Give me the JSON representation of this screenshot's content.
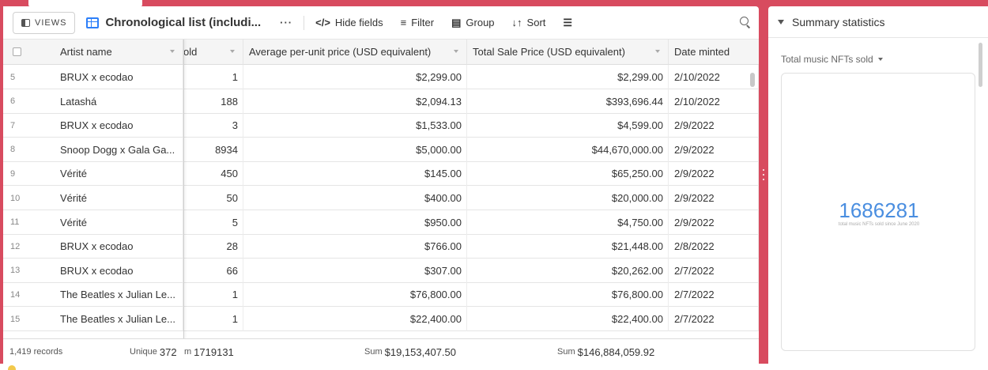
{
  "toolbar": {
    "views_label": "VIEWS",
    "view_name": "Chronological list (includi...",
    "more_label": "···",
    "hide_fields_label": "Hide fields",
    "filter_label": "Filter",
    "group_label": "Group",
    "sort_label": "Sort",
    "icons": [
      "views-icon",
      "grid-view-icon",
      "more-icon",
      "hide-fields-icon",
      "filter-icon",
      "group-icon",
      "sort-icon",
      "row-height-icon",
      "search-icon"
    ]
  },
  "table": {
    "columns": [
      {
        "key": "artist",
        "label": "Artist name"
      },
      {
        "key": "sold",
        "label": "old"
      },
      {
        "key": "avg",
        "label": "Average per-unit price (USD equivalent)"
      },
      {
        "key": "total",
        "label": "Total Sale Price (USD equivalent)"
      },
      {
        "key": "date",
        "label": "Date minted"
      }
    ],
    "rows": [
      {
        "n": "5",
        "artist": "BRUX x ecodao",
        "sold": "1",
        "avg": "$2,299.00",
        "total": "$2,299.00",
        "date": "2/10/2022"
      },
      {
        "n": "6",
        "artist": "Latashá",
        "sold": "188",
        "avg": "$2,094.13",
        "total": "$393,696.44",
        "date": "2/10/2022"
      },
      {
        "n": "7",
        "artist": "BRUX x ecodao",
        "sold": "3",
        "avg": "$1,533.00",
        "total": "$4,599.00",
        "date": "2/9/2022"
      },
      {
        "n": "8",
        "artist": "Snoop Dogg x Gala Ga...",
        "sold": "8934",
        "avg": "$5,000.00",
        "total": "$44,670,000.00",
        "date": "2/9/2022"
      },
      {
        "n": "9",
        "artist": "Vérité",
        "sold": "450",
        "avg": "$145.00",
        "total": "$65,250.00",
        "date": "2/9/2022"
      },
      {
        "n": "10",
        "artist": "Vérité",
        "sold": "50",
        "avg": "$400.00",
        "total": "$20,000.00",
        "date": "2/9/2022"
      },
      {
        "n": "11",
        "artist": "Vérité",
        "sold": "5",
        "avg": "$950.00",
        "total": "$4,750.00",
        "date": "2/9/2022"
      },
      {
        "n": "12",
        "artist": "BRUX x ecodao",
        "sold": "28",
        "avg": "$766.00",
        "total": "$21,448.00",
        "date": "2/8/2022"
      },
      {
        "n": "13",
        "artist": "BRUX x ecodao",
        "sold": "66",
        "avg": "$307.00",
        "total": "$20,262.00",
        "date": "2/7/2022"
      },
      {
        "n": "14",
        "artist": "The Beatles x Julian Le...",
        "sold": "1",
        "avg": "$76,800.00",
        "total": "$76,800.00",
        "date": "2/7/2022"
      },
      {
        "n": "15",
        "artist": "The Beatles x Julian Le...",
        "sold": "1",
        "avg": "$22,400.00",
        "total": "$22,400.00",
        "date": "2/7/2022"
      }
    ],
    "footer": {
      "records": "1,419 records",
      "unique_label": "Unique",
      "unique_value": "372",
      "sold_sum_prefix": "m",
      "sold_sum_value": "1719131",
      "avg_sum_label": "Sum",
      "avg_sum_value": "$19,153,407.50",
      "total_sum_label": "Sum",
      "total_sum_value": "$146,884,059.92"
    }
  },
  "summary": {
    "title": "Summary statistics",
    "metric_label": "Total music NFTs sold",
    "big_number": "1686281",
    "caption": "total music NFTs sold since June 2020"
  },
  "colors": {
    "frame": "#d84b5f",
    "accent_blue": "#2d7ff9",
    "big_number": "#4a8ee0"
  }
}
